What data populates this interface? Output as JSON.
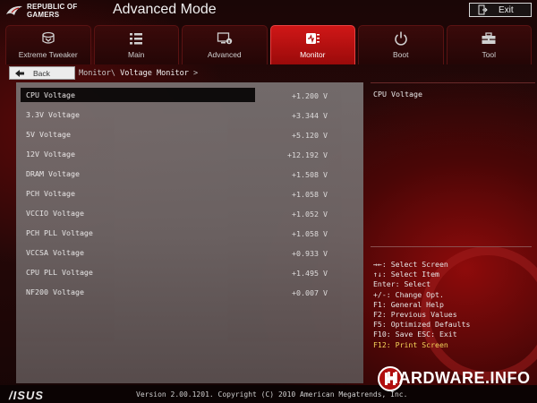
{
  "header": {
    "brand_line1": "REPUBLIC OF",
    "brand_line2": "GAMERS",
    "mode_title": "Advanced Mode",
    "exit_label": "Exit"
  },
  "tabs": [
    {
      "label": "Extreme Tweaker",
      "icon": "tweaker-icon",
      "active": false
    },
    {
      "label": "Main",
      "icon": "list-icon",
      "active": false
    },
    {
      "label": "Advanced",
      "icon": "advanced-icon",
      "active": false
    },
    {
      "label": "Monitor",
      "icon": "monitor-icon",
      "active": true
    },
    {
      "label": "Boot",
      "icon": "power-icon",
      "active": false
    },
    {
      "label": "Tool",
      "icon": "toolbox-icon",
      "active": false
    }
  ],
  "nav": {
    "back_label": "Back",
    "breadcrumb_parent": "Monitor\\",
    "breadcrumb_current": "Voltage Monitor",
    "breadcrumb_suffix": ">"
  },
  "voltages": [
    {
      "name": "CPU Voltage",
      "value": "+1.200 V",
      "selected": true
    },
    {
      "name": "3.3V Voltage",
      "value": "+3.344 V"
    },
    {
      "name": "5V Voltage",
      "value": "+5.120 V"
    },
    {
      "name": "12V Voltage",
      "value": "+12.192 V"
    },
    {
      "name": "DRAM Voltage",
      "value": "+1.508 V"
    },
    {
      "name": "PCH Voltage",
      "value": "+1.058 V"
    },
    {
      "name": "VCCIO Voltage",
      "value": "+1.052 V"
    },
    {
      "name": "PCH PLL Voltage",
      "value": "+1.058 V"
    },
    {
      "name": "VCCSA Voltage",
      "value": "+0.933 V"
    },
    {
      "name": "CPU PLL Voltage",
      "value": "+1.495 V"
    },
    {
      "name": "NF200 Voltage",
      "value": "+0.007 V"
    }
  ],
  "help": {
    "title": "CPU Voltage",
    "keys": [
      "→←: Select Screen",
      "↑↓: Select Item",
      "Enter: Select",
      "+/-: Change Opt.",
      "F1: General Help",
      "F2: Previous Values",
      "F5: Optimized Defaults",
      "F10: Save  ESC: Exit",
      "F12: Print Screen"
    ]
  },
  "footer": {
    "asus_logo": "/ISUS",
    "version": "Version 2.00.1201. Copyright (C) 2010 American Megatrends, Inc.",
    "watermark": "HARDWARE.INFO"
  },
  "colors": {
    "accent": "#d01717",
    "highlight_key": "#f6d65a",
    "selected_row": "#0d0d0d"
  }
}
